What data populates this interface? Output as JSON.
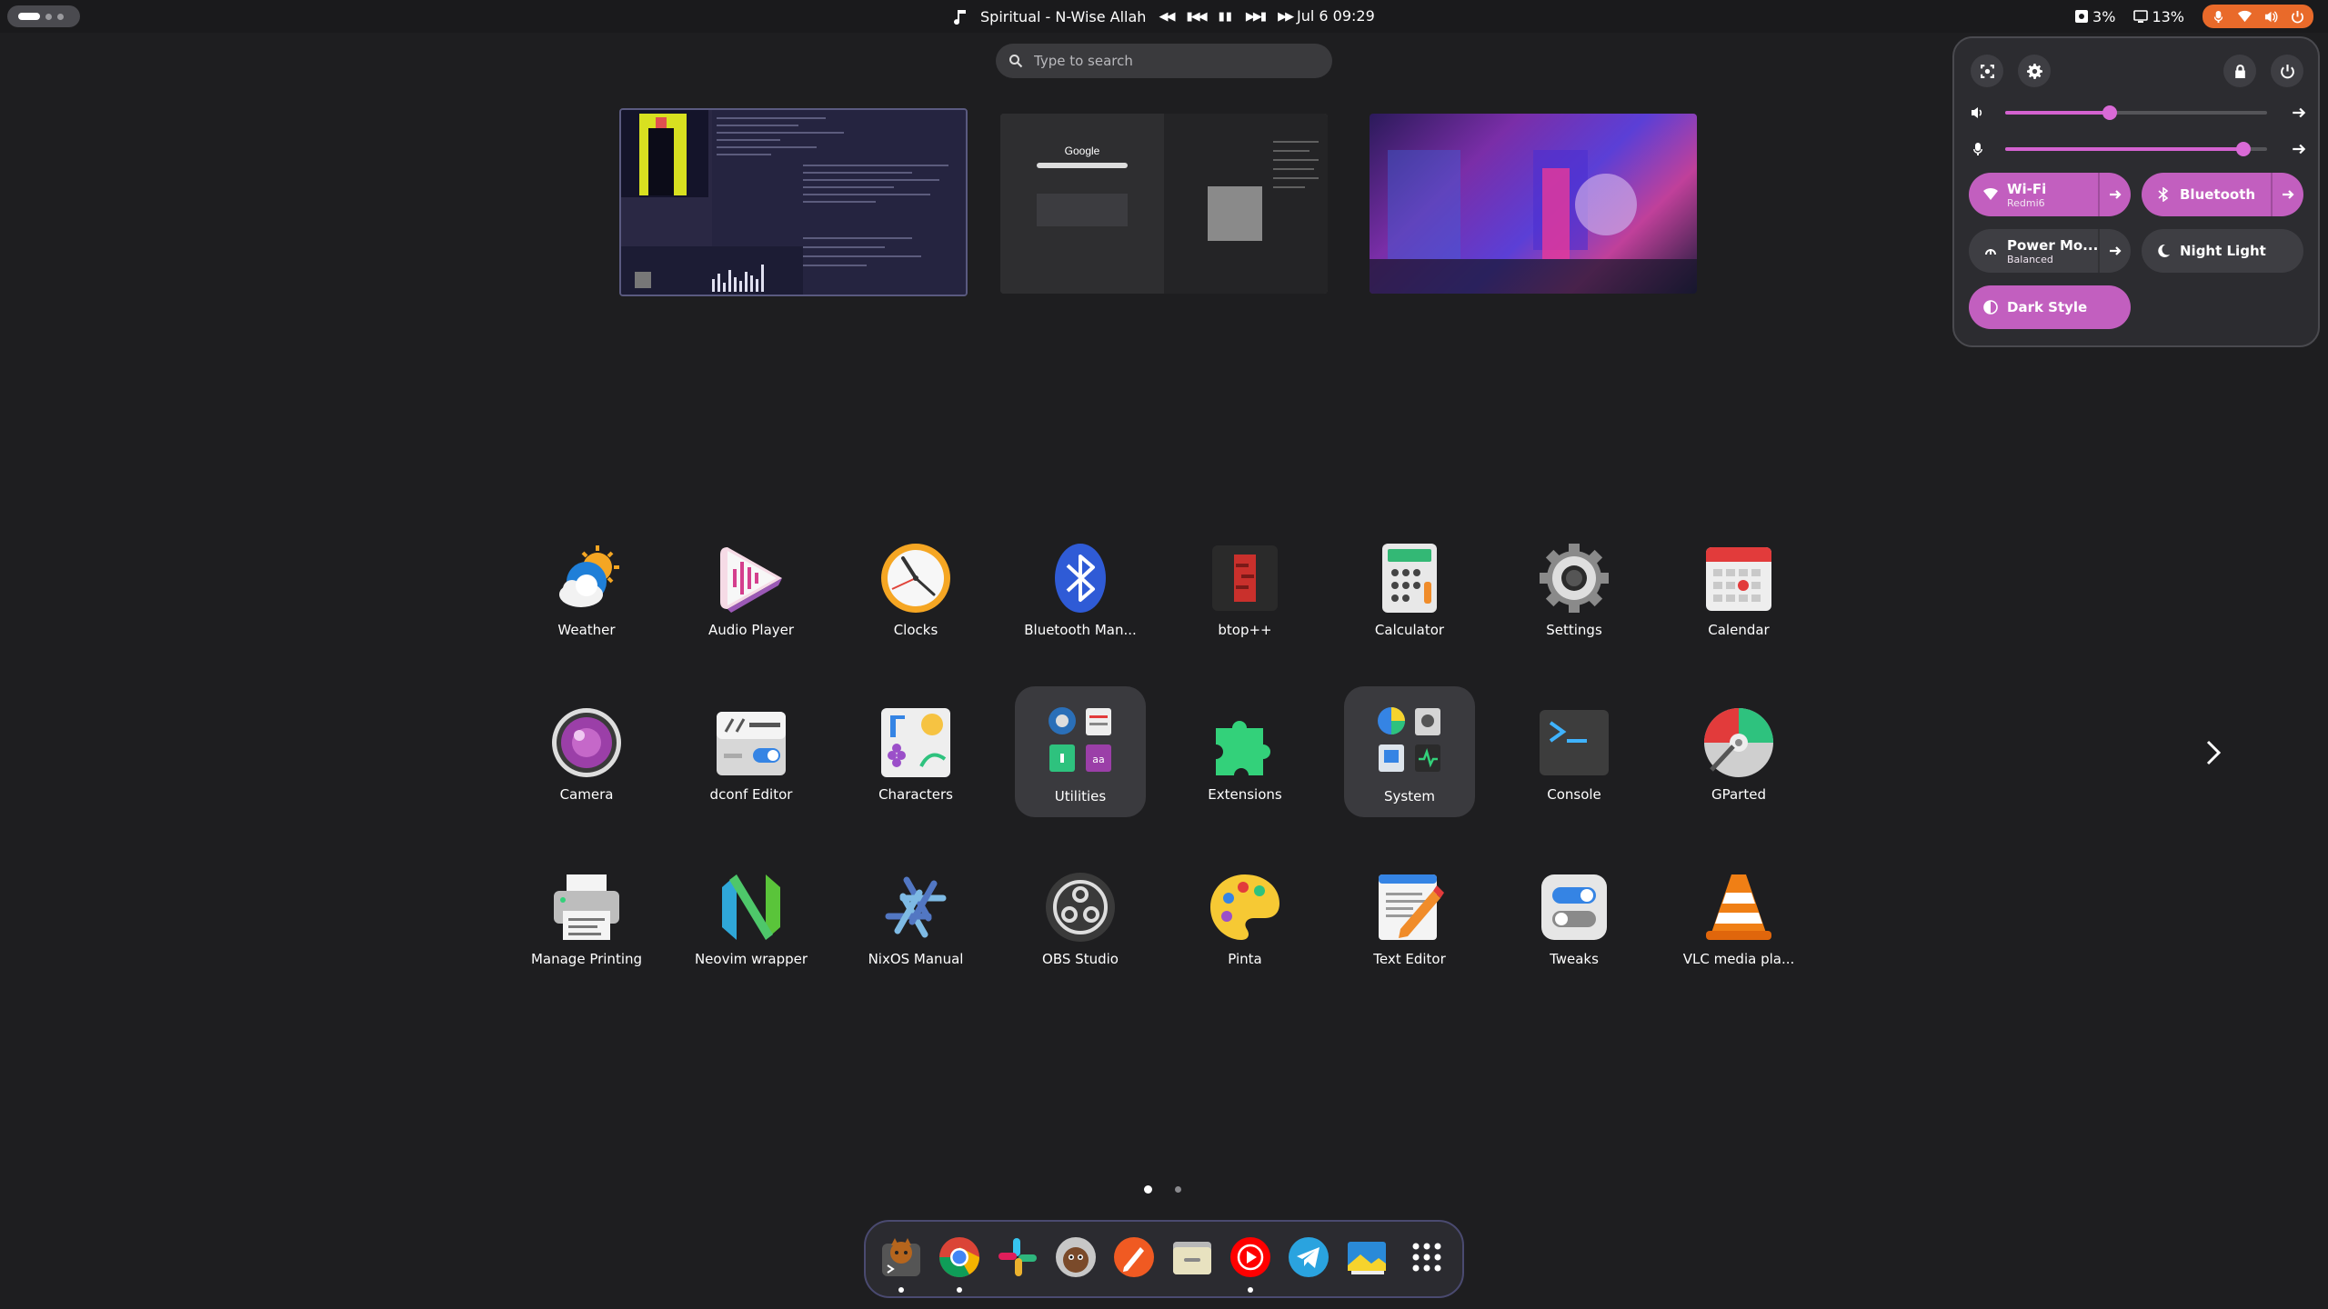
{
  "topbar": {
    "media": {
      "track": "Spiritual - N-Wise Allah",
      "controls": [
        "seek-back",
        "previous",
        "pause",
        "next",
        "seek-forward"
      ]
    },
    "clock": "Jul 6  09:29",
    "disk_usage": "3%",
    "memory_usage": "13%",
    "status_icons": [
      "microphone-icon",
      "wifi-icon",
      "volume-icon",
      "power-icon"
    ],
    "accent_color": "#e96a2a"
  },
  "search": {
    "placeholder": "Type to search"
  },
  "workspaces": {
    "count": 3,
    "ws2_text": "Google"
  },
  "quick_settings": {
    "volume_level": 0.4,
    "mic_level": 0.91,
    "tiles": {
      "wifi": {
        "label": "Wi-Fi",
        "sub": "Redmi6",
        "on": true
      },
      "bluetooth": {
        "label": "Bluetooth",
        "on": true
      },
      "power": {
        "label": "Power Mo...",
        "sub": "Balanced",
        "on": false
      },
      "night": {
        "label": "Night Light",
        "on": false
      },
      "dark": {
        "label": "Dark Style",
        "on": true
      }
    },
    "accent": "#c25fbf"
  },
  "apps": [
    "Weather",
    "Audio Player",
    "Clocks",
    "Bluetooth Man...",
    "btop++",
    "Calculator",
    "Settings",
    "Calendar",
    "Camera",
    "dconf Editor",
    "Characters",
    "Utilities",
    "Extensions",
    "System",
    "Console",
    "GParted",
    "Manage Printing",
    "Neovim wrapper",
    "NixOS Manual",
    "OBS Studio",
    "Pinta",
    "Text Editor",
    "Tweaks",
    "VLC media pla..."
  ],
  "pages": {
    "count": 2,
    "current": 1
  },
  "dash": {
    "items": [
      "terminal-fox",
      "chrome",
      "slack",
      "face-app",
      "pen-app",
      "files",
      "youtube-music",
      "telegram",
      "image-viewer",
      "app-grid"
    ],
    "running": [
      0,
      1,
      6
    ]
  }
}
